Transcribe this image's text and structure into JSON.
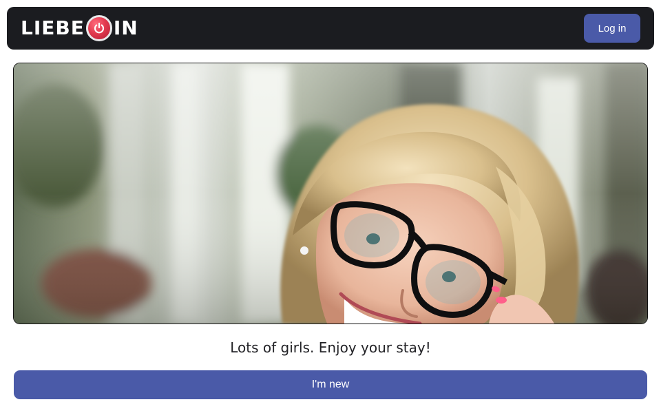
{
  "header": {
    "logo": {
      "text_left": "LIEBE",
      "text_right": "IN",
      "badge_icon": "power-icon"
    },
    "login_label": "Log in"
  },
  "hero": {
    "image": "smiling blonde woman wearing black glasses"
  },
  "tagline": "Lots of girls. Enjoy your stay!",
  "new_button_label": "I'm new",
  "colors": {
    "header_bg": "#1b1c20",
    "button_bg": "#4a5aa8",
    "badge_red": "#e23a4f",
    "text": "#222226"
  }
}
